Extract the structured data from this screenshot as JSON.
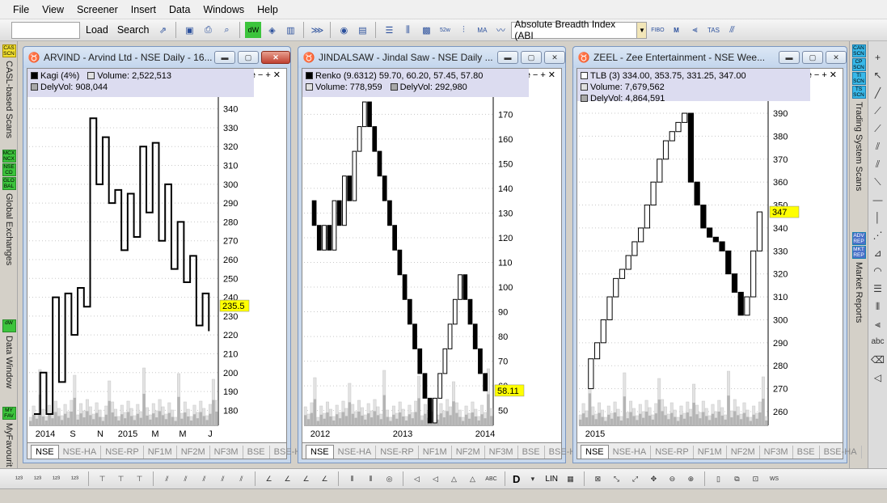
{
  "menu": [
    "File",
    "View",
    "Screener",
    "Insert",
    "Data",
    "Windows",
    "Help"
  ],
  "toolbar": {
    "load": "Load",
    "search": "Search",
    "indicator": "Absolute Breadth Index (ABI"
  },
  "left_tabs": [
    {
      "icon": "CAS SCN",
      "label": "CASL-based Scans"
    },
    {
      "icon": "MCX NCX",
      "label": ""
    },
    {
      "icon": "NSE CD",
      "label": ""
    },
    {
      "icon": "GLO BAL",
      "label": "Global Exchanges"
    },
    {
      "icon": "dW",
      "label": "Data Window"
    },
    {
      "icon": "MY FAV",
      "label": "MyFavourit"
    }
  ],
  "right_tabs": [
    {
      "icon": "CAN SCN"
    },
    {
      "icon": "CP SCN"
    },
    {
      "icon": "TI SCN"
    },
    {
      "icon": "TS SCN"
    },
    {
      "label": "Trading System Scans"
    },
    {
      "icon": "ADV REP"
    },
    {
      "icon": "MKT REP"
    },
    {
      "label": "Market Reports"
    }
  ],
  "bottom_text": {
    "d": "D",
    "lin": "LIN"
  },
  "symbol_tabs": [
    "NSE",
    "NSE-HA",
    "NSE-RP",
    "NF1M",
    "NF2M",
    "NF3M",
    "BSE",
    "BSE-HA"
  ],
  "charts": [
    {
      "caption": "ARVIND - Arvind Ltd - NSE Daily - 16...",
      "legend1": "Kagi (4%)",
      "legend2": "Volume: 2,522,513",
      "legend3": "DelyVol: 908,044",
      "price_label": "235.5",
      "price_ticks": [
        "340",
        "330",
        "320",
        "310",
        "300",
        "290",
        "280",
        "270",
        "260",
        "250",
        "240",
        "230",
        "220",
        "210",
        "200",
        "190",
        "180"
      ],
      "date_ticks": [
        "2014",
        "S",
        "N",
        "2015",
        "M",
        "M",
        "J"
      ],
      "chart_data": {
        "type": "kagi",
        "title": "ARVIND - Arvind Ltd - NSE Daily",
        "ylim": [
          172,
          345
        ],
        "last": 235.5,
        "values": [
          178,
          200,
          178,
          240,
          195,
          242,
          220,
          245,
          235,
          335,
          300,
          325,
          290,
          297,
          265,
          295,
          272,
          320,
          285,
          322,
          270,
          300,
          255,
          280,
          248,
          262,
          225,
          242,
          222
        ]
      }
    },
    {
      "caption": "JINDALSAW - Jindal Saw - NSE Daily ...",
      "legend1": "Renko (9.6312) 59.70, 60.20, 57.45, 57.80",
      "legend2": "Volume: 778,959",
      "legend3": "DelyVol: 292,980",
      "price_label": "58.11",
      "price_ticks": [
        "170",
        "160",
        "150",
        "140",
        "130",
        "120",
        "110",
        "100",
        "90",
        "80",
        "70",
        "60",
        "50"
      ],
      "date_ticks": [
        "2012",
        "2013",
        "2014"
      ],
      "chart_data": {
        "type": "renko",
        "title": "JINDALSAW - Jindal Saw - NSE Daily",
        "ylim": [
          44,
          176
        ],
        "last": 58.11,
        "brick": 9.6312,
        "values": [
          135,
          125,
          115,
          125,
          115,
          135,
          125,
          145,
          135,
          155,
          165,
          175,
          165,
          155,
          145,
          135,
          125,
          115,
          105,
          95,
          85,
          75,
          65,
          55,
          45,
          55,
          65,
          75,
          85,
          95,
          105,
          95,
          85,
          75,
          65,
          58
        ]
      }
    },
    {
      "caption": "ZEEL - Zee Entertainment - NSE Wee...",
      "legend1": "TLB (3) 334.00, 353.75, 331.25, 347.00",
      "legend2": "Volume: 7,679,562",
      "legend3": "DelyVol: 4,864,591",
      "price_label": "347",
      "price_ticks": [
        "390",
        "380",
        "370",
        "360",
        "350",
        "340",
        "330",
        "320",
        "310",
        "300",
        "290",
        "280",
        "270",
        "260"
      ],
      "date_ticks": [
        "2015"
      ],
      "chart_data": {
        "type": "three-line-break",
        "title": "ZEEL - Zee Entertainment - NSE Weekly",
        "ylim": [
          254,
          396
        ],
        "last": 347,
        "values": [
          270,
          283,
          290,
          300,
          310,
          318,
          322,
          328,
          334,
          340,
          350,
          360,
          370,
          378,
          382,
          386,
          390,
          360,
          350,
          340,
          336,
          334,
          330,
          320,
          312,
          302,
          310,
          330,
          347
        ]
      }
    }
  ]
}
